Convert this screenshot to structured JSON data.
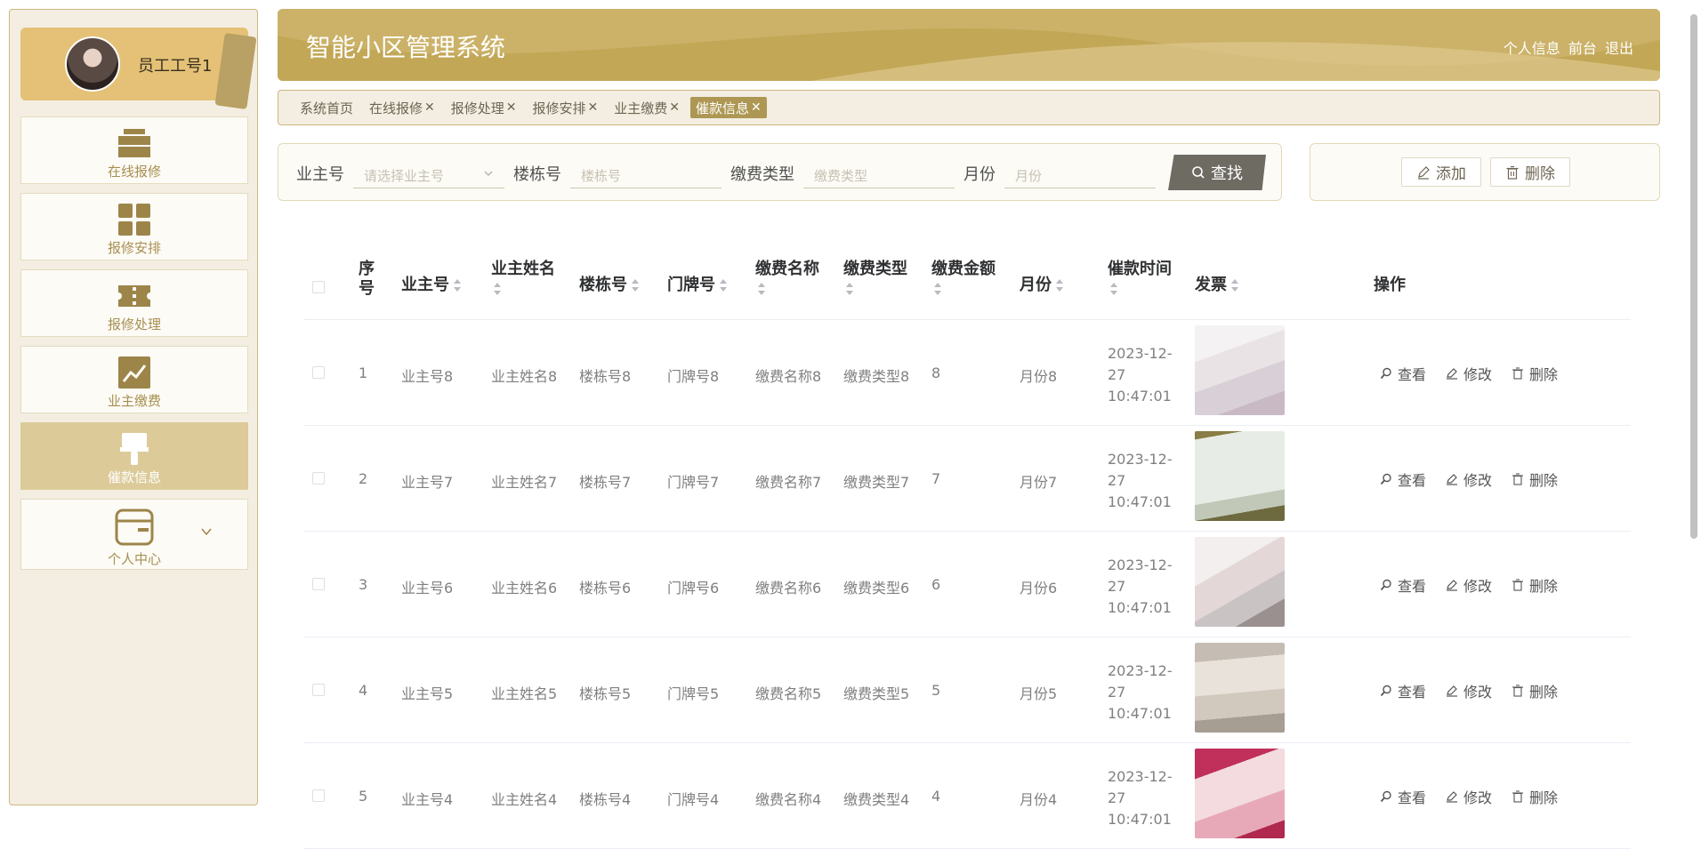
{
  "sidebar": {
    "user_name": "员工工号1",
    "items": [
      {
        "label": "在线报修",
        "icon": "briefcase-icon"
      },
      {
        "label": "报修安排",
        "icon": "grid-icon"
      },
      {
        "label": "报修处理",
        "icon": "ticket-icon"
      },
      {
        "label": "业主缴费",
        "icon": "trend-chart-icon"
      },
      {
        "label": "催款信息",
        "icon": "brush-icon"
      },
      {
        "label": "个人中心",
        "icon": "wallet-icon"
      }
    ]
  },
  "header": {
    "title": "智能小区管理系统",
    "links": [
      "个人信息",
      "前台",
      "退出"
    ]
  },
  "tabs": [
    {
      "label": "系统首页",
      "closable": false
    },
    {
      "label": "在线报修",
      "closable": true
    },
    {
      "label": "报修处理",
      "closable": true
    },
    {
      "label": "报修安排",
      "closable": true
    },
    {
      "label": "业主缴费",
      "closable": true
    },
    {
      "label": "催款信息",
      "closable": true
    }
  ],
  "search": {
    "owner_no_label": "业主号",
    "owner_no_placeholder": "请选择业主号",
    "building_label": "楼栋号",
    "building_placeholder": "楼栋号",
    "fee_type_label": "缴费类型",
    "fee_type_placeholder": "缴费类型",
    "month_label": "月份",
    "month_placeholder": "月份",
    "search_button": "查找"
  },
  "actions": {
    "add": "添加",
    "delete": "删除"
  },
  "table": {
    "headers": {
      "index": "序号",
      "owner_no": "业主号",
      "owner_name": "业主姓名",
      "building": "楼栋号",
      "door": "门牌号",
      "fee_name": "缴费名称",
      "fee_type": "缴费类型",
      "amount": "缴费金额",
      "month": "月份",
      "reminder_time": "催款时间",
      "invoice": "发票",
      "operations": "操作"
    },
    "op_labels": {
      "view": "查看",
      "edit": "修改",
      "delete": "删除"
    },
    "rows": [
      {
        "index": "1",
        "owner_no": "业主号8",
        "owner_name": "业主姓名8",
        "building": "楼栋号8",
        "door": "门牌号8",
        "fee_name": "缴费名称8",
        "fee_type": "缴费类型8",
        "amount": "8",
        "month": "月份8",
        "time": "2023-12-27 10:47:01"
      },
      {
        "index": "2",
        "owner_no": "业主号7",
        "owner_name": "业主姓名7",
        "building": "楼栋号7",
        "door": "门牌号7",
        "fee_name": "缴费名称7",
        "fee_type": "缴费类型7",
        "amount": "7",
        "month": "月份7",
        "time": "2023-12-27 10:47:01"
      },
      {
        "index": "3",
        "owner_no": "业主号6",
        "owner_name": "业主姓名6",
        "building": "楼栋号6",
        "door": "门牌号6",
        "fee_name": "缴费名称6",
        "fee_type": "缴费类型6",
        "amount": "6",
        "month": "月份6",
        "time": "2023-12-27 10:47:01"
      },
      {
        "index": "4",
        "owner_no": "业主号5",
        "owner_name": "业主姓名5",
        "building": "楼栋号5",
        "door": "门牌号5",
        "fee_name": "缴费名称5",
        "fee_type": "缴费类型5",
        "amount": "5",
        "month": "月份5",
        "time": "2023-12-27 10:47:01"
      },
      {
        "index": "5",
        "owner_no": "业主号4",
        "owner_name": "业主姓名4",
        "building": "楼栋号4",
        "door": "门牌号4",
        "fee_name": "缴费名称4",
        "fee_type": "缴费类型4",
        "amount": "4",
        "month": "月份4",
        "time": "2023-12-27 10:47:01"
      }
    ]
  },
  "colors": {
    "accent": "#c5a95a",
    "sidebar_bg": "#f3eee1",
    "active_nav": "#dccb99",
    "active_tab": "#ad9753"
  }
}
